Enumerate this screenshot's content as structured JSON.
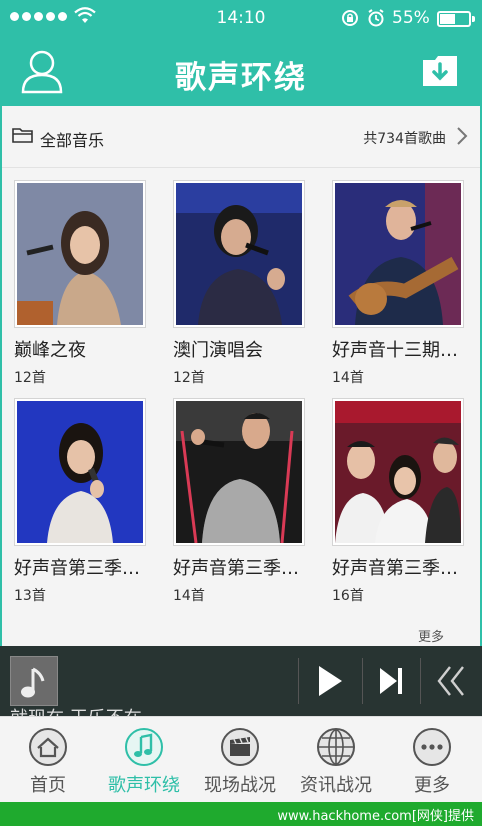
{
  "status_bar": {
    "time": "14:10",
    "battery": "55%",
    "battery_level": 0.55
  },
  "nav": {
    "title": "歌声环绕"
  },
  "albums_header": {
    "label": "全部音乐",
    "count": "共734首歌曲"
  },
  "albums": [
    {
      "name": "巅峰之夜",
      "tracks": "12首"
    },
    {
      "name": "澳门演唱会",
      "tracks": "12首"
    },
    {
      "name": "好声音十三期…",
      "tracks": "14首"
    },
    {
      "name": "好声音第三季…",
      "tracks": "13首"
    },
    {
      "name": "好声音第三季…",
      "tracks": "14首"
    },
    {
      "name": "好声音第三季…",
      "tracks": "16首"
    }
  ],
  "more_label": "更多",
  "player": {
    "partial_text": "就现在 王乐不在"
  },
  "tabs": [
    {
      "label": "首页",
      "icon": "home-icon"
    },
    {
      "label": "歌声环绕",
      "icon": "music-note-icon"
    },
    {
      "label": "现场战况",
      "icon": "clapperboard-icon"
    },
    {
      "label": "资讯战况",
      "icon": "globe-icon"
    },
    {
      "label": "更多",
      "icon": "more-icon"
    }
  ],
  "footer": {
    "text": "www.hackhome.com[网侠]提供"
  },
  "colors": {
    "accent": "#2fbfa8",
    "footer": "#1faa2e"
  }
}
